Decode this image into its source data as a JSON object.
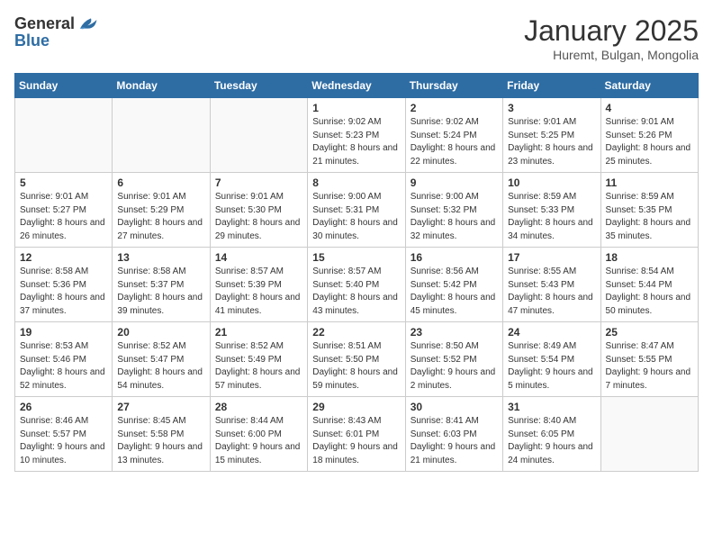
{
  "header": {
    "logo_general": "General",
    "logo_blue": "Blue",
    "month": "January 2025",
    "location": "Huremt, Bulgan, Mongolia"
  },
  "weekdays": [
    "Sunday",
    "Monday",
    "Tuesday",
    "Wednesday",
    "Thursday",
    "Friday",
    "Saturday"
  ],
  "weeks": [
    [
      {
        "day": "",
        "sunrise": "",
        "sunset": "",
        "daylight": ""
      },
      {
        "day": "",
        "sunrise": "",
        "sunset": "",
        "daylight": ""
      },
      {
        "day": "",
        "sunrise": "",
        "sunset": "",
        "daylight": ""
      },
      {
        "day": "1",
        "sunrise": "Sunrise: 9:02 AM",
        "sunset": "Sunset: 5:23 PM",
        "daylight": "Daylight: 8 hours and 21 minutes."
      },
      {
        "day": "2",
        "sunrise": "Sunrise: 9:02 AM",
        "sunset": "Sunset: 5:24 PM",
        "daylight": "Daylight: 8 hours and 22 minutes."
      },
      {
        "day": "3",
        "sunrise": "Sunrise: 9:01 AM",
        "sunset": "Sunset: 5:25 PM",
        "daylight": "Daylight: 8 hours and 23 minutes."
      },
      {
        "day": "4",
        "sunrise": "Sunrise: 9:01 AM",
        "sunset": "Sunset: 5:26 PM",
        "daylight": "Daylight: 8 hours and 25 minutes."
      }
    ],
    [
      {
        "day": "5",
        "sunrise": "Sunrise: 9:01 AM",
        "sunset": "Sunset: 5:27 PM",
        "daylight": "Daylight: 8 hours and 26 minutes."
      },
      {
        "day": "6",
        "sunrise": "Sunrise: 9:01 AM",
        "sunset": "Sunset: 5:29 PM",
        "daylight": "Daylight: 8 hours and 27 minutes."
      },
      {
        "day": "7",
        "sunrise": "Sunrise: 9:01 AM",
        "sunset": "Sunset: 5:30 PM",
        "daylight": "Daylight: 8 hours and 29 minutes."
      },
      {
        "day": "8",
        "sunrise": "Sunrise: 9:00 AM",
        "sunset": "Sunset: 5:31 PM",
        "daylight": "Daylight: 8 hours and 30 minutes."
      },
      {
        "day": "9",
        "sunrise": "Sunrise: 9:00 AM",
        "sunset": "Sunset: 5:32 PM",
        "daylight": "Daylight: 8 hours and 32 minutes."
      },
      {
        "day": "10",
        "sunrise": "Sunrise: 8:59 AM",
        "sunset": "Sunset: 5:33 PM",
        "daylight": "Daylight: 8 hours and 34 minutes."
      },
      {
        "day": "11",
        "sunrise": "Sunrise: 8:59 AM",
        "sunset": "Sunset: 5:35 PM",
        "daylight": "Daylight: 8 hours and 35 minutes."
      }
    ],
    [
      {
        "day": "12",
        "sunrise": "Sunrise: 8:58 AM",
        "sunset": "Sunset: 5:36 PM",
        "daylight": "Daylight: 8 hours and 37 minutes."
      },
      {
        "day": "13",
        "sunrise": "Sunrise: 8:58 AM",
        "sunset": "Sunset: 5:37 PM",
        "daylight": "Daylight: 8 hours and 39 minutes."
      },
      {
        "day": "14",
        "sunrise": "Sunrise: 8:57 AM",
        "sunset": "Sunset: 5:39 PM",
        "daylight": "Daylight: 8 hours and 41 minutes."
      },
      {
        "day": "15",
        "sunrise": "Sunrise: 8:57 AM",
        "sunset": "Sunset: 5:40 PM",
        "daylight": "Daylight: 8 hours and 43 minutes."
      },
      {
        "day": "16",
        "sunrise": "Sunrise: 8:56 AM",
        "sunset": "Sunset: 5:42 PM",
        "daylight": "Daylight: 8 hours and 45 minutes."
      },
      {
        "day": "17",
        "sunrise": "Sunrise: 8:55 AM",
        "sunset": "Sunset: 5:43 PM",
        "daylight": "Daylight: 8 hours and 47 minutes."
      },
      {
        "day": "18",
        "sunrise": "Sunrise: 8:54 AM",
        "sunset": "Sunset: 5:44 PM",
        "daylight": "Daylight: 8 hours and 50 minutes."
      }
    ],
    [
      {
        "day": "19",
        "sunrise": "Sunrise: 8:53 AM",
        "sunset": "Sunset: 5:46 PM",
        "daylight": "Daylight: 8 hours and 52 minutes."
      },
      {
        "day": "20",
        "sunrise": "Sunrise: 8:52 AM",
        "sunset": "Sunset: 5:47 PM",
        "daylight": "Daylight: 8 hours and 54 minutes."
      },
      {
        "day": "21",
        "sunrise": "Sunrise: 8:52 AM",
        "sunset": "Sunset: 5:49 PM",
        "daylight": "Daylight: 8 hours and 57 minutes."
      },
      {
        "day": "22",
        "sunrise": "Sunrise: 8:51 AM",
        "sunset": "Sunset: 5:50 PM",
        "daylight": "Daylight: 8 hours and 59 minutes."
      },
      {
        "day": "23",
        "sunrise": "Sunrise: 8:50 AM",
        "sunset": "Sunset: 5:52 PM",
        "daylight": "Daylight: 9 hours and 2 minutes."
      },
      {
        "day": "24",
        "sunrise": "Sunrise: 8:49 AM",
        "sunset": "Sunset: 5:54 PM",
        "daylight": "Daylight: 9 hours and 5 minutes."
      },
      {
        "day": "25",
        "sunrise": "Sunrise: 8:47 AM",
        "sunset": "Sunset: 5:55 PM",
        "daylight": "Daylight: 9 hours and 7 minutes."
      }
    ],
    [
      {
        "day": "26",
        "sunrise": "Sunrise: 8:46 AM",
        "sunset": "Sunset: 5:57 PM",
        "daylight": "Daylight: 9 hours and 10 minutes."
      },
      {
        "day": "27",
        "sunrise": "Sunrise: 8:45 AM",
        "sunset": "Sunset: 5:58 PM",
        "daylight": "Daylight: 9 hours and 13 minutes."
      },
      {
        "day": "28",
        "sunrise": "Sunrise: 8:44 AM",
        "sunset": "Sunset: 6:00 PM",
        "daylight": "Daylight: 9 hours and 15 minutes."
      },
      {
        "day": "29",
        "sunrise": "Sunrise: 8:43 AM",
        "sunset": "Sunset: 6:01 PM",
        "daylight": "Daylight: 9 hours and 18 minutes."
      },
      {
        "day": "30",
        "sunrise": "Sunrise: 8:41 AM",
        "sunset": "Sunset: 6:03 PM",
        "daylight": "Daylight: 9 hours and 21 minutes."
      },
      {
        "day": "31",
        "sunrise": "Sunrise: 8:40 AM",
        "sunset": "Sunset: 6:05 PM",
        "daylight": "Daylight: 9 hours and 24 minutes."
      },
      {
        "day": "",
        "sunrise": "",
        "sunset": "",
        "daylight": ""
      }
    ]
  ]
}
